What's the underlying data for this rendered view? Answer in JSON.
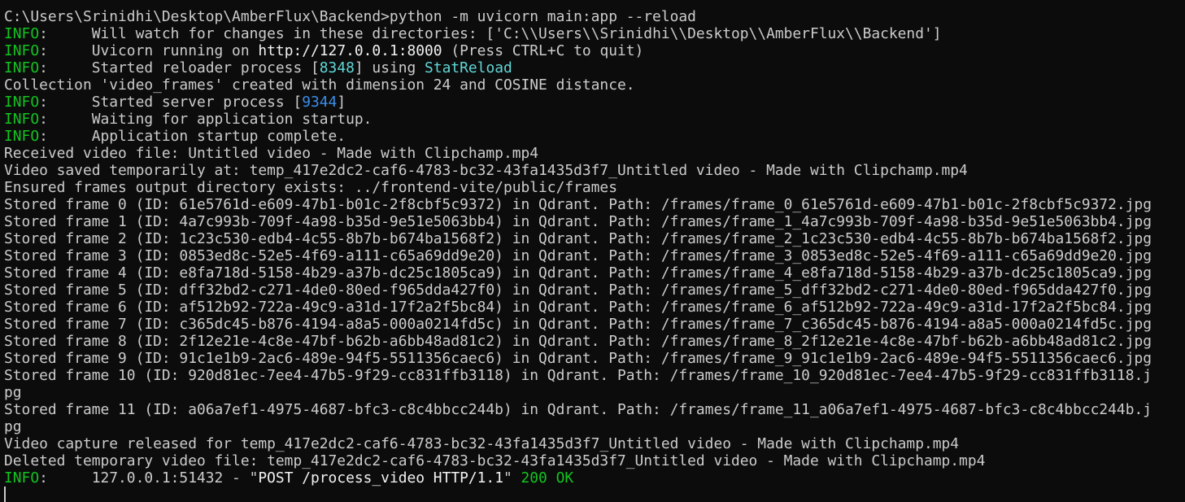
{
  "terminal": {
    "lines": [
      {
        "segments": [
          {
            "text": "C:\\Users\\Srinidhi\\Desktop\\AmberFlux\\Backend>python -m uvicorn main:app --reload",
            "style": "plain"
          }
        ]
      },
      {
        "segments": [
          {
            "text": "INFO",
            "style": "info"
          },
          {
            "text": ":     Will watch for changes in these directories: ['C:\\\\Users\\\\Srinidhi\\\\Desktop\\\\AmberFlux\\\\Backend']",
            "style": "plain"
          }
        ]
      },
      {
        "segments": [
          {
            "text": "INFO",
            "style": "info"
          },
          {
            "text": ":     Uvicorn running on ",
            "style": "plain"
          },
          {
            "text": "http://127.0.0.1:8000",
            "style": "bright"
          },
          {
            "text": " (Press CTRL+C to quit)",
            "style": "plain"
          }
        ]
      },
      {
        "segments": [
          {
            "text": "INFO",
            "style": "info"
          },
          {
            "text": ":     Started reloader process [",
            "style": "plain"
          },
          {
            "text": "8348",
            "style": "cyan"
          },
          {
            "text": "] using ",
            "style": "plain"
          },
          {
            "text": "StatReload",
            "style": "cyan"
          }
        ]
      },
      {
        "segments": [
          {
            "text": "Collection 'video_frames' created with dimension 24 and COSINE distance.",
            "style": "plain"
          }
        ]
      },
      {
        "segments": [
          {
            "text": "INFO",
            "style": "info"
          },
          {
            "text": ":     Started server process [",
            "style": "plain"
          },
          {
            "text": "9344",
            "style": "blue"
          },
          {
            "text": "]",
            "style": "plain"
          }
        ]
      },
      {
        "segments": [
          {
            "text": "INFO",
            "style": "info"
          },
          {
            "text": ":     Waiting for application startup.",
            "style": "plain"
          }
        ]
      },
      {
        "segments": [
          {
            "text": "INFO",
            "style": "info"
          },
          {
            "text": ":     Application startup complete.",
            "style": "plain"
          }
        ]
      },
      {
        "segments": [
          {
            "text": "Received video file: Untitled video - Made with Clipchamp.mp4",
            "style": "plain"
          }
        ]
      },
      {
        "segments": [
          {
            "text": "Video saved temporarily at: temp_417e2dc2-caf6-4783-bc32-43fa1435d3f7_Untitled video - Made with Clipchamp.mp4",
            "style": "plain"
          }
        ]
      },
      {
        "segments": [
          {
            "text": "Ensured frames output directory exists: ../frontend-vite/public/frames",
            "style": "plain"
          }
        ]
      },
      {
        "segments": [
          {
            "text": "Stored frame 0 (ID: 61e5761d-e609-47b1-b01c-2f8cbf5c9372) in Qdrant. Path: /frames/frame_0_61e5761d-e609-47b1-b01c-2f8cbf5c9372.jpg",
            "style": "plain"
          }
        ]
      },
      {
        "segments": [
          {
            "text": "Stored frame 1 (ID: 4a7c993b-709f-4a98-b35d-9e51e5063bb4) in Qdrant. Path: /frames/frame_1_4a7c993b-709f-4a98-b35d-9e51e5063bb4.jpg",
            "style": "plain"
          }
        ]
      },
      {
        "segments": [
          {
            "text": "Stored frame 2 (ID: 1c23c530-edb4-4c55-8b7b-b674ba1568f2) in Qdrant. Path: /frames/frame_2_1c23c530-edb4-4c55-8b7b-b674ba1568f2.jpg",
            "style": "plain"
          }
        ]
      },
      {
        "segments": [
          {
            "text": "Stored frame 3 (ID: 0853ed8c-52e5-4f69-a111-c65a69dd9e20) in Qdrant. Path: /frames/frame_3_0853ed8c-52e5-4f69-a111-c65a69dd9e20.jpg",
            "style": "plain"
          }
        ]
      },
      {
        "segments": [
          {
            "text": "Stored frame 4 (ID: e8fa718d-5158-4b29-a37b-dc25c1805ca9) in Qdrant. Path: /frames/frame_4_e8fa718d-5158-4b29-a37b-dc25c1805ca9.jpg",
            "style": "plain"
          }
        ]
      },
      {
        "segments": [
          {
            "text": "Stored frame 5 (ID: dff32bd2-c271-4de0-80ed-f965dda427f0) in Qdrant. Path: /frames/frame_5_dff32bd2-c271-4de0-80ed-f965dda427f0.jpg",
            "style": "plain"
          }
        ]
      },
      {
        "segments": [
          {
            "text": "Stored frame 6 (ID: af512b92-722a-49c9-a31d-17f2a2f5bc84) in Qdrant. Path: /frames/frame_6_af512b92-722a-49c9-a31d-17f2a2f5bc84.jpg",
            "style": "plain"
          }
        ]
      },
      {
        "segments": [
          {
            "text": "Stored frame 7 (ID: c365dc45-b876-4194-a8a5-000a0214fd5c) in Qdrant. Path: /frames/frame_7_c365dc45-b876-4194-a8a5-000a0214fd5c.jpg",
            "style": "plain"
          }
        ]
      },
      {
        "segments": [
          {
            "text": "Stored frame 8 (ID: 2f12e21e-4c8e-47bf-b62b-a6bb48ad81c2) in Qdrant. Path: /frames/frame_8_2f12e21e-4c8e-47bf-b62b-a6bb48ad81c2.jpg",
            "style": "plain"
          }
        ]
      },
      {
        "segments": [
          {
            "text": "Stored frame 9 (ID: 91c1e1b9-2ac6-489e-94f5-5511356caec6) in Qdrant. Path: /frames/frame_9_91c1e1b9-2ac6-489e-94f5-5511356caec6.jpg",
            "style": "plain"
          }
        ]
      },
      {
        "segments": [
          {
            "text": "Stored frame 10 (ID: 920d81ec-7ee4-47b5-9f29-cc831ffb3118) in Qdrant. Path: /frames/frame_10_920d81ec-7ee4-47b5-9f29-cc831ffb3118.j",
            "style": "plain"
          }
        ]
      },
      {
        "segments": [
          {
            "text": "pg",
            "style": "plain"
          }
        ]
      },
      {
        "segments": [
          {
            "text": "Stored frame 11 (ID: a06a7ef1-4975-4687-bfc3-c8c4bbcc244b) in Qdrant. Path: /frames/frame_11_a06a7ef1-4975-4687-bfc3-c8c4bbcc244b.j",
            "style": "plain"
          }
        ]
      },
      {
        "segments": [
          {
            "text": "pg",
            "style": "plain"
          }
        ]
      },
      {
        "segments": [
          {
            "text": "Video capture released for temp_417e2dc2-caf6-4783-bc32-43fa1435d3f7_Untitled video - Made with Clipchamp.mp4",
            "style": "plain"
          }
        ]
      },
      {
        "segments": [
          {
            "text": "Deleted temporary video file: temp_417e2dc2-caf6-4783-bc32-43fa1435d3f7_Untitled video - Made with Clipchamp.mp4",
            "style": "plain"
          }
        ]
      },
      {
        "segments": [
          {
            "text": "INFO",
            "style": "info"
          },
          {
            "text": ":     127.0.0.1:51432 - \"",
            "style": "plain"
          },
          {
            "text": "POST /process_video HTTP/1.1",
            "style": "bright"
          },
          {
            "text": "\" ",
            "style": "plain"
          },
          {
            "text": "200 OK",
            "style": "green"
          }
        ]
      }
    ]
  },
  "colors": {
    "background": "#0c0c0c",
    "foreground": "#cccccc",
    "info": "#13c421",
    "cyan": "#61d6d6",
    "blue": "#3b8eea",
    "bright": "#f2f2f2"
  }
}
